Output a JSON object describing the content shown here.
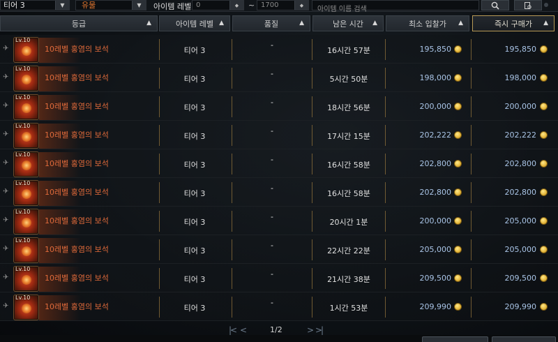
{
  "filters": {
    "tier_value": "티어 3",
    "category_value": "유물",
    "item_level_label": "아이템 레벨",
    "level_min": "0",
    "level_separator": "~",
    "level_max": "1700",
    "search_placeholder": "아이템 이름 검색"
  },
  "columns": [
    {
      "label": "등급"
    },
    {
      "label": "아이템 레벨"
    },
    {
      "label": "품질"
    },
    {
      "label": "남은 시간"
    },
    {
      "label": "최소 입찰가"
    },
    {
      "label": "즉시 구매가"
    }
  ],
  "sort_arrow": "▲",
  "rows": [
    {
      "level_badge": "Lv.10",
      "name": "10레벨 홍염의 보석",
      "tier": "티어 3",
      "quality": "-",
      "time_left": "16시간 57분",
      "min_bid": "195,850",
      "buy_now": "195,850"
    },
    {
      "level_badge": "Lv.10",
      "name": "10레벨 홍염의 보석",
      "tier": "티어 3",
      "quality": "-",
      "time_left": "5시간 50분",
      "min_bid": "198,000",
      "buy_now": "198,000"
    },
    {
      "level_badge": "Lv.10",
      "name": "10레벨 홍염의 보석",
      "tier": "티어 3",
      "quality": "-",
      "time_left": "18시간 56분",
      "min_bid": "200,000",
      "buy_now": "200,000"
    },
    {
      "level_badge": "Lv.10",
      "name": "10레벨 홍염의 보석",
      "tier": "티어 3",
      "quality": "-",
      "time_left": "17시간 15분",
      "min_bid": "202,222",
      "buy_now": "202,222"
    },
    {
      "level_badge": "Lv.10",
      "name": "10레벨 홍염의 보석",
      "tier": "티어 3",
      "quality": "-",
      "time_left": "16시간 58분",
      "min_bid": "202,800",
      "buy_now": "202,800"
    },
    {
      "level_badge": "Lv.10",
      "name": "10레벨 홍염의 보석",
      "tier": "티어 3",
      "quality": "-",
      "time_left": "16시간 58분",
      "min_bid": "202,800",
      "buy_now": "202,800"
    },
    {
      "level_badge": "Lv.10",
      "name": "10레벨 홍염의 보석",
      "tier": "티어 3",
      "quality": "-",
      "time_left": "20시간 1분",
      "min_bid": "200,000",
      "buy_now": "205,000"
    },
    {
      "level_badge": "Lv.10",
      "name": "10레벨 홍염의 보석",
      "tier": "티어 3",
      "quality": "-",
      "time_left": "22시간 22분",
      "min_bid": "205,000",
      "buy_now": "205,000"
    },
    {
      "level_badge": "Lv.10",
      "name": "10레벨 홍염의 보석",
      "tier": "티어 3",
      "quality": "-",
      "time_left": "21시간 38분",
      "min_bid": "209,500",
      "buy_now": "209,500"
    },
    {
      "level_badge": "Lv.10",
      "name": "10레벨 홍염의 보석",
      "tier": "티어 3",
      "quality": "-",
      "time_left": "1시간 53분",
      "min_bid": "209,990",
      "buy_now": "209,990"
    }
  ],
  "pagination": {
    "first": "|<",
    "prev": "<",
    "page": "1/2",
    "next": ">",
    "last": ">|"
  },
  "colors": {
    "item_name": "#e06a3a",
    "price": "#a9c4e6",
    "active_header_border": "#b89a56"
  },
  "icons": {
    "pin": "pin-icon",
    "coin": "gold-coin-icon",
    "search": "search-icon",
    "search_settings": "search-settings-icon"
  }
}
